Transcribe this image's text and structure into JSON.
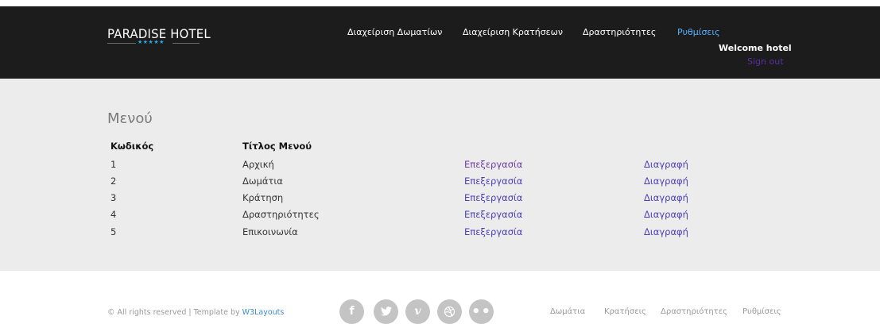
{
  "header": {
    "logo_text": "PARADISE HOTEL",
    "logo_stars": "★★★★★",
    "nav": [
      {
        "label": "Διαχείριση Δωματίων",
        "active": false
      },
      {
        "label": "Διαχείριση Κρατήσεων",
        "active": false
      },
      {
        "label": "Δραστηριότητες",
        "active": false
      },
      {
        "label": "Ρυθμίσεις",
        "active": true
      }
    ],
    "welcome": "Welcome hotel",
    "sign_out": "Sign out"
  },
  "main": {
    "title": "Μενού",
    "table": {
      "headers": [
        "Κωδικός",
        "Τίτλος Μενού"
      ],
      "edit_label": "Επεξεργασία",
      "delete_label": "Διαγραφή",
      "rows": [
        {
          "id": "1",
          "title": "Αρχική"
        },
        {
          "id": "2",
          "title": "Δωμάτια"
        },
        {
          "id": "3",
          "title": "Κράτηση"
        },
        {
          "id": "4",
          "title": "Δραστηριότητες"
        },
        {
          "id": "5",
          "title": "Επικοινωνία"
        }
      ]
    }
  },
  "footer": {
    "copyright": "© All rights reserved | Template by",
    "copyright_link": "W3Layouts",
    "social": [
      "facebook-icon",
      "twitter-icon",
      "vimeo-icon",
      "dribbble-icon",
      "flickr-icon"
    ],
    "nav": [
      "Δωμάτια",
      "Κρατήσεις",
      "Δραστηριότητες",
      "Ρυθμίσεις"
    ]
  },
  "colors": {
    "header_bg": "#1c1c1c",
    "content_bg": "#ececec",
    "active_nav": "#5ab3ff",
    "edit_link": "#6d3ba8",
    "delete_link": "#4a3fb5",
    "sign_out": "#5a2ea8"
  }
}
